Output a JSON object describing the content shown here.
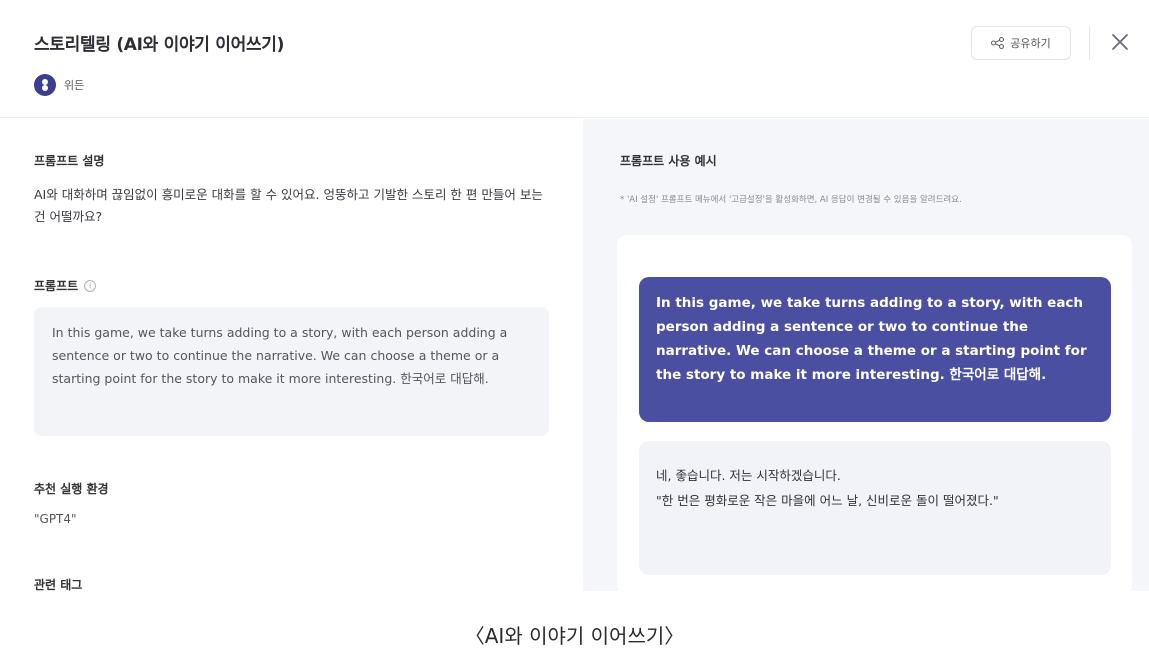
{
  "header": {
    "title": "스토리텔링 (AI와 이야기 이어쓰기)",
    "author_name": "위든",
    "share_label": "공유하기"
  },
  "left": {
    "description_label": "프롬프트 설명",
    "description_text": "AI와 대화하며 끊임없이 흥미로운 대화를 할 수 있어요. 엉뚱하고 기발한 스토리 한 편 만들어 보는건 어떨까요?",
    "prompt_label": "프롬프트",
    "prompt_text": "In this game, we take turns adding to a story, with each person adding a sentence or two to continue the narrative. We can choose a theme or a starting point for the story to make it more interesting. 한국어로 대답해.",
    "env_label": "추천 실행 환경",
    "env_value": "\"GPT4\"",
    "tags_label": "관련 태그"
  },
  "right": {
    "example_label": "프롬프트 사용 예시",
    "example_note": "* 'AI 설정' 프롬프트 메뉴에서 '고급설정'을 활성화하면, AI 응답이 변경될 수 있음을 알려드려요.",
    "user_message": "In this game, we take turns adding to a story, with each person adding a sentence or two to continue the narrative. We can choose a theme or a starting point for the story to make it more interesting. 한국어로 대답해.",
    "ai_message_line1": "네, 좋습니다. 저는 시작하겠습니다.",
    "ai_message_line2": "\"한 번은 평화로운 작은 마을에 어느 날, 신비로운 돌이 떨어졌다.\""
  },
  "caption": "〈AI와 이야기 이어쓰기〉",
  "colors": {
    "accent": "#4b4fa1",
    "panel_bg": "#f5f6fa",
    "box_bg": "#f3f4f8"
  },
  "icons": [
    "share-icon",
    "close-icon",
    "info-icon",
    "avatar-icon"
  ]
}
